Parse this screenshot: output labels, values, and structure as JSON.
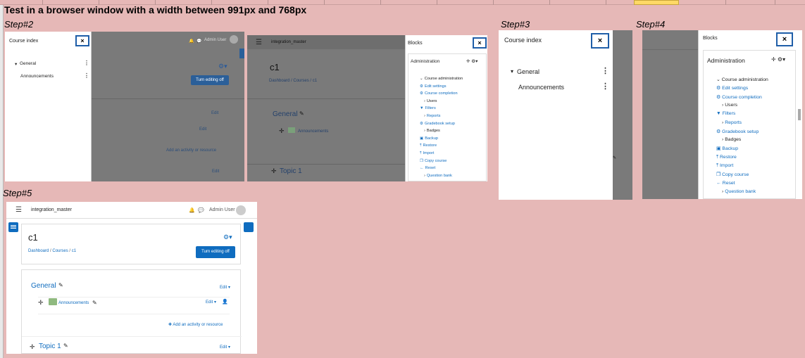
{
  "heading": "Test in a browser window with a width between 991px and 768px",
  "steps": {
    "s2": "Step#2",
    "s3": "Step#3",
    "s4": "Step#4",
    "s5": "Step#5"
  },
  "course_index": {
    "title": "Course index",
    "close": "×",
    "section": "General",
    "activity": "Announcements"
  },
  "blocks": {
    "title": "Blocks",
    "close": "×",
    "admin_title": "Administration",
    "items": [
      {
        "label": "Course administration",
        "icon": "chevron-down"
      },
      {
        "label": "Edit settings",
        "icon": "gear"
      },
      {
        "label": "Course completion",
        "icon": "gear"
      },
      {
        "label": "Users",
        "icon": "chevron-right"
      },
      {
        "label": "Filters",
        "icon": "filter"
      },
      {
        "label": "Reports",
        "icon": "chevron-right"
      },
      {
        "label": "Gradebook setup",
        "icon": "gear"
      },
      {
        "label": "Badges",
        "icon": "chevron-right"
      },
      {
        "label": "Backup",
        "icon": "backup"
      },
      {
        "label": "Restore",
        "icon": "restore"
      },
      {
        "label": "Import",
        "icon": "import"
      },
      {
        "label": "Copy course",
        "icon": "copy"
      },
      {
        "label": "Reset",
        "icon": "reset"
      },
      {
        "label": "Question bank",
        "icon": "chevron-right"
      }
    ]
  },
  "course": {
    "site": "integration_master",
    "user": "Admin User",
    "name": "c1",
    "breadcrumb": [
      "Dashboard",
      "Courses",
      "c1"
    ],
    "crumb_sep": "/",
    "edit_button": "Turn editing off",
    "section_general": "General",
    "section_topic": "Topic 1",
    "activity": "Announcements",
    "edit": "Edit",
    "add": "Add an activity or resource"
  },
  "colors": {
    "background": "#e6b8b7",
    "accent": "#0f6cbf",
    "highlight_border": "#1f5ea8",
    "overlay": "#888888"
  }
}
